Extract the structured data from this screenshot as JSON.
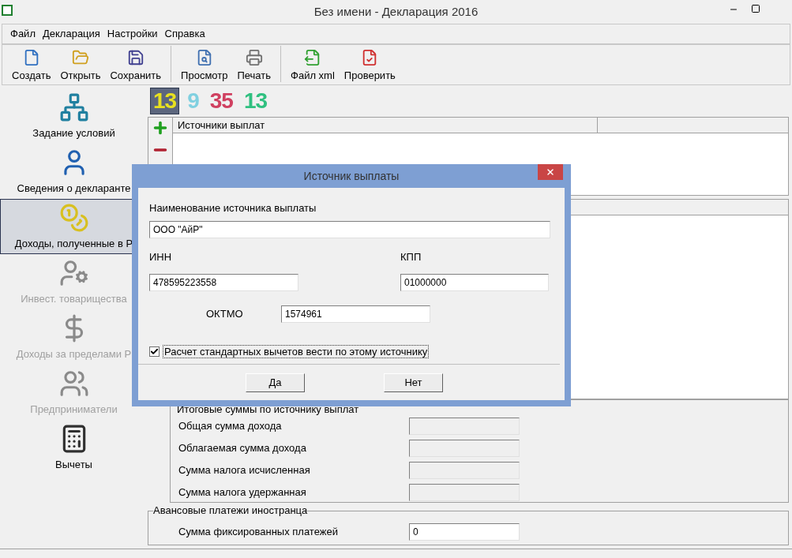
{
  "window": {
    "title": "Без имени - Декларация 2016"
  },
  "menu": [
    "Файл",
    "Декларация",
    "Настройки",
    "Справка"
  ],
  "toolbar": [
    [
      "Создать",
      "Открыть",
      "Сохранить"
    ],
    [
      "Просмотр",
      "Печать"
    ],
    [
      "Файл xml",
      "Проверить"
    ]
  ],
  "sidebar": {
    "items": [
      {
        "label": "Задание условий",
        "selected": false,
        "disabled": false
      },
      {
        "label": "Сведения о декларанте",
        "selected": false,
        "disabled": false
      },
      {
        "label": "Доходы, полученные в Р",
        "selected": true,
        "disabled": false
      },
      {
        "label": "Инвест. товарищества",
        "selected": false,
        "disabled": true
      },
      {
        "label": "Доходы за пределами Р",
        "selected": false,
        "disabled": true
      },
      {
        "label": "Предприниматели",
        "selected": false,
        "disabled": true
      },
      {
        "label": "Вычеты",
        "selected": false,
        "disabled": false
      }
    ]
  },
  "rates": [
    {
      "label": "13",
      "color": "#e8e020",
      "selected": true
    },
    {
      "label": "9",
      "color": "#80d0e0",
      "selected": false
    },
    {
      "label": "35",
      "color": "#d04060",
      "selected": false
    },
    {
      "label": "13",
      "color": "#30c080",
      "selected": false
    }
  ],
  "sources_table": {
    "columns": [
      "Источники выплат"
    ]
  },
  "totals": {
    "title": "Итоговые суммы по источнику выплат",
    "rows": [
      "Общая сумма дохода",
      "Облагаемая сумма дохода",
      "Сумма налога исчисленная",
      "Сумма налога удержанная"
    ]
  },
  "advance": {
    "title": "Авансовые платежи иностранца",
    "label": "Сумма фиксированных платежей",
    "value": "0"
  },
  "dialog": {
    "title": "Источник выплаты",
    "name_label": "Наименование источника выплаты",
    "name_value": "ООО \"АйР\"",
    "inn_label": "ИНН",
    "inn_value": "478595223558",
    "kpp_label": "КПП",
    "kpp_value": "01000000",
    "oktmo_label": "ОКТМО",
    "oktmo_value": "1574961",
    "checkbox": {
      "label": "Расчет стандартных вычетов вести по этому источнику",
      "checked": true
    },
    "buttons": [
      "Да",
      "Нет"
    ]
  }
}
